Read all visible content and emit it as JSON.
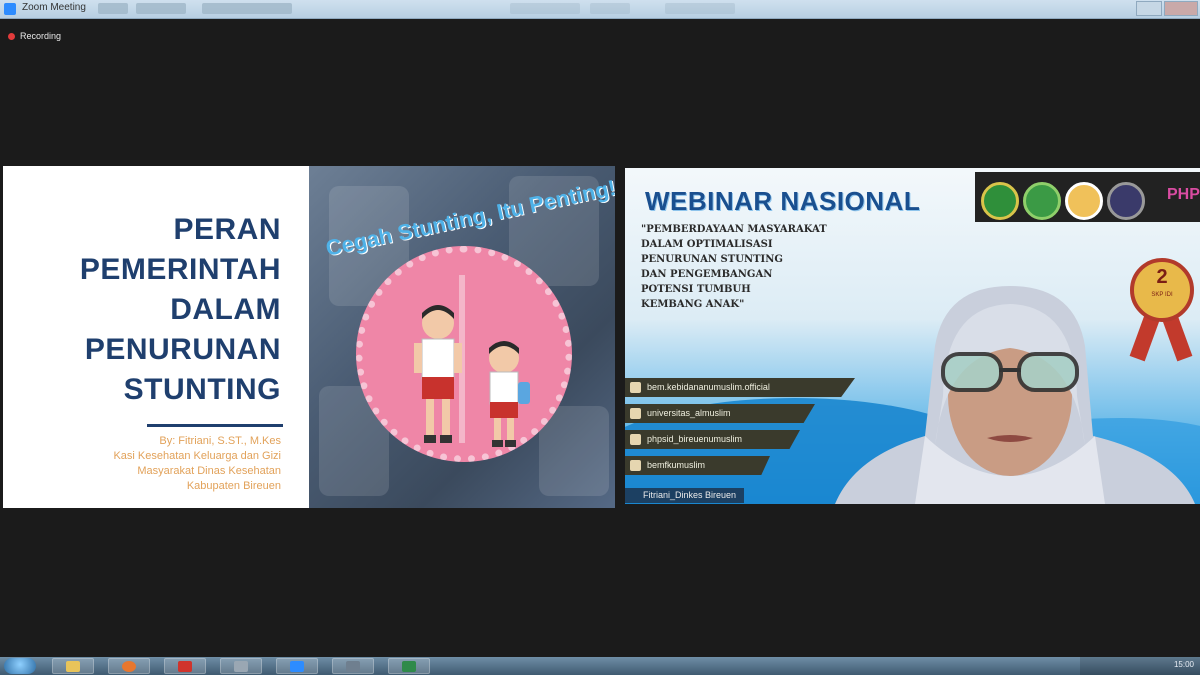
{
  "window": {
    "title": "Zoom Meeting"
  },
  "recording": {
    "label": "Recording"
  },
  "left_slide": {
    "heading_lines": [
      "PERAN",
      "PEMERINTAH",
      "DALAM",
      "PENURUNAN",
      "STUNTING"
    ],
    "author_lines": [
      "By: Fitriani, S.ST., M.Kes",
      "Kasi Kesehatan Keluarga dan Gizi",
      "Masyarakat Dinas Kesehatan",
      "Kabupaten Bireuen"
    ],
    "badge_text": "Cegah Stunting, Itu Penting!"
  },
  "video": {
    "title": "WEBINAR NASIONAL",
    "theme_lines": [
      "\"PEMBERDAYAAN MASYARAKAT",
      "DALAM OPTIMALISASI",
      "PENURUNAN STUNTING",
      "DAN PENGEMBANGAN",
      "POTENSI TUMBUH",
      "KEMBANG ANAK\""
    ],
    "logo_text": "PHPS",
    "medal": {
      "number": "2",
      "caption": "SKP IDI"
    },
    "socials": [
      "bem.kebidananumuslim.official",
      "universitas_almuslim",
      "phpsid_bireuenumuslim",
      "bemfkumuslim"
    ],
    "participant_name": "Fitriani_Dinkes Bireuen"
  },
  "taskbar": {
    "clock": "15:00"
  },
  "colors": {
    "slide_navy": "#1f3f6e",
    "accent_orange": "#e2a25a",
    "badge_pink": "#ef86a7"
  }
}
